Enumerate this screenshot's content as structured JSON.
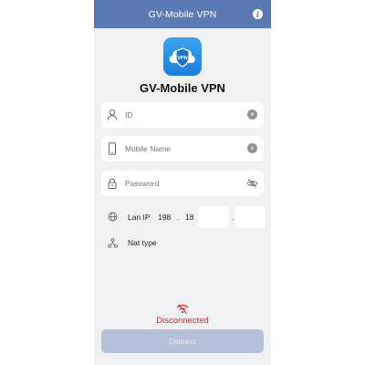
{
  "header": {
    "title": "GV-Mobile VPN"
  },
  "app": {
    "name": "GV-Mobile VPN",
    "logo_text": "VPN"
  },
  "fields": {
    "id": {
      "placeholder": "ID",
      "value": ""
    },
    "mobile_name": {
      "placeholder": "Mobile Name",
      "value": ""
    },
    "password": {
      "placeholder": "Password",
      "value": ""
    }
  },
  "lan": {
    "label": "Lan IP",
    "octet1": "198",
    "octet2": "18",
    "octet3": "",
    "octet4": "",
    "separator": "."
  },
  "nat": {
    "label": "Nat type"
  },
  "status": {
    "text": "Disconnected",
    "color": "#c0282d"
  },
  "actions": {
    "connect_label": "Connect"
  },
  "colors": {
    "header": "#5b79b3",
    "background": "#f1f1f4",
    "connect_disabled": "#b4c1d8"
  },
  "icons": {
    "info": "info-icon",
    "id": "person-icon",
    "mobile_name": "phone-icon",
    "password": "lock-icon",
    "lan": "globe-icon",
    "nat": "network-icon",
    "status": "wifi-off-icon",
    "password_toggle": "eye-off-icon",
    "clear": "clear-icon"
  }
}
